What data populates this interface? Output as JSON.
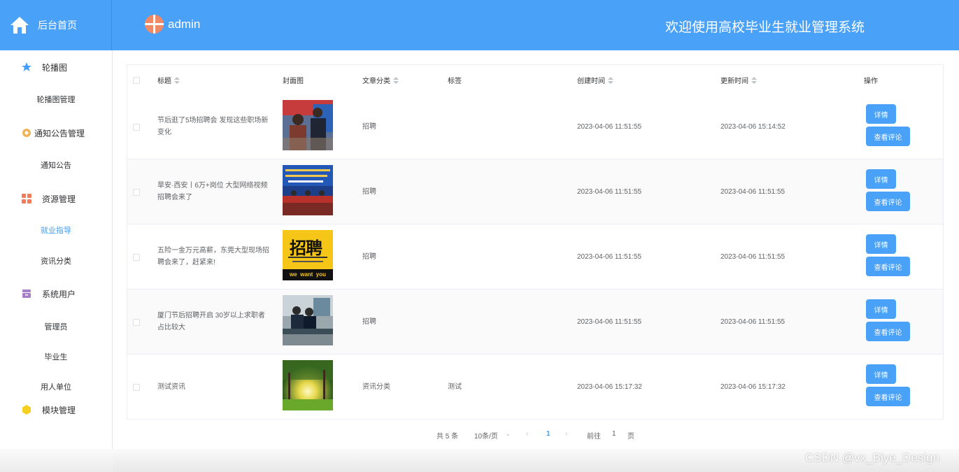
{
  "header": {
    "home_label": "后台首页",
    "username": "admin",
    "system_title": "欢迎使用高校毕业生就业管理系统"
  },
  "sidebar": {
    "groups": [
      {
        "label": "轮播图",
        "icon": "star-icon",
        "children": [
          "轮播图管理"
        ]
      },
      {
        "label": "通知公告管理",
        "icon": "gear-icon",
        "children": [
          "通知公告"
        ]
      },
      {
        "label": "资源管理",
        "icon": "grid-icon",
        "children": [
          "就业指导",
          "资讯分类"
        ]
      },
      {
        "label": "系统用户",
        "icon": "archive-icon",
        "children": [
          "管理员",
          "毕业生",
          "用人单位"
        ]
      },
      {
        "label": "模块管理",
        "icon": "hexagon-icon",
        "children": []
      }
    ],
    "active_item": "就业指导"
  },
  "table": {
    "columns": [
      "标题",
      "封面图",
      "文章分类",
      "标签",
      "创建时间",
      "更新时间",
      "操作"
    ],
    "rows": [
      {
        "title_line1": "节后逛了5场招聘会 发现这些职场新",
        "title_line2": "变化",
        "cover": "recruitment-fair-photo",
        "category": "招聘",
        "tag": "",
        "created": "2023-04-06 11:51:55",
        "updated": "2023-04-06 15:14:52"
      },
      {
        "title_line1": "旱安·西安丨6万+岗位 大型网络视频",
        "title_line2": "招聘会来了",
        "cover": "stage-event-photo",
        "category": "招聘",
        "tag": "",
        "created": "2023-04-06 11:51:55",
        "updated": "2023-04-06 11:51:55"
      },
      {
        "title_line1": "五险一金万元高薪，东莞大型现场招",
        "title_line2": "聘会来了，赶紧来!",
        "cover": "we-want-you-poster",
        "category": "招聘",
        "tag": "",
        "created": "2023-04-06 11:51:55",
        "updated": "2023-04-06 11:51:55"
      },
      {
        "title_line1": "厦门节后招聘开启 30岁以上求职者",
        "title_line2": "占比较大",
        "cover": "job-interview-photo",
        "category": "招聘",
        "tag": "",
        "created": "2023-04-06 11:51:55",
        "updated": "2023-04-06 11:51:55"
      },
      {
        "title_line1": "测试资讯",
        "title_line2": "",
        "cover": "sunlight-forest-photo",
        "category": "资讯分类",
        "tag": "测试",
        "created": "2023-04-06 15:17:32",
        "updated": "2023-04-06 15:17:32"
      }
    ],
    "btn_detail": "详情",
    "btn_comment": "查看评论",
    "poster_text_big": "招聘",
    "poster_text_small": "we  want  you"
  },
  "pagination": {
    "total": "共 5 条",
    "page_size": "10条/页",
    "current": "1",
    "goto_prefix": "前往",
    "goto_value": "1",
    "goto_suffix": "页"
  },
  "watermark": "CSDN @vx_Biye_Design",
  "colors": {
    "header": "#4aa1f8",
    "primary": "#409eff"
  }
}
